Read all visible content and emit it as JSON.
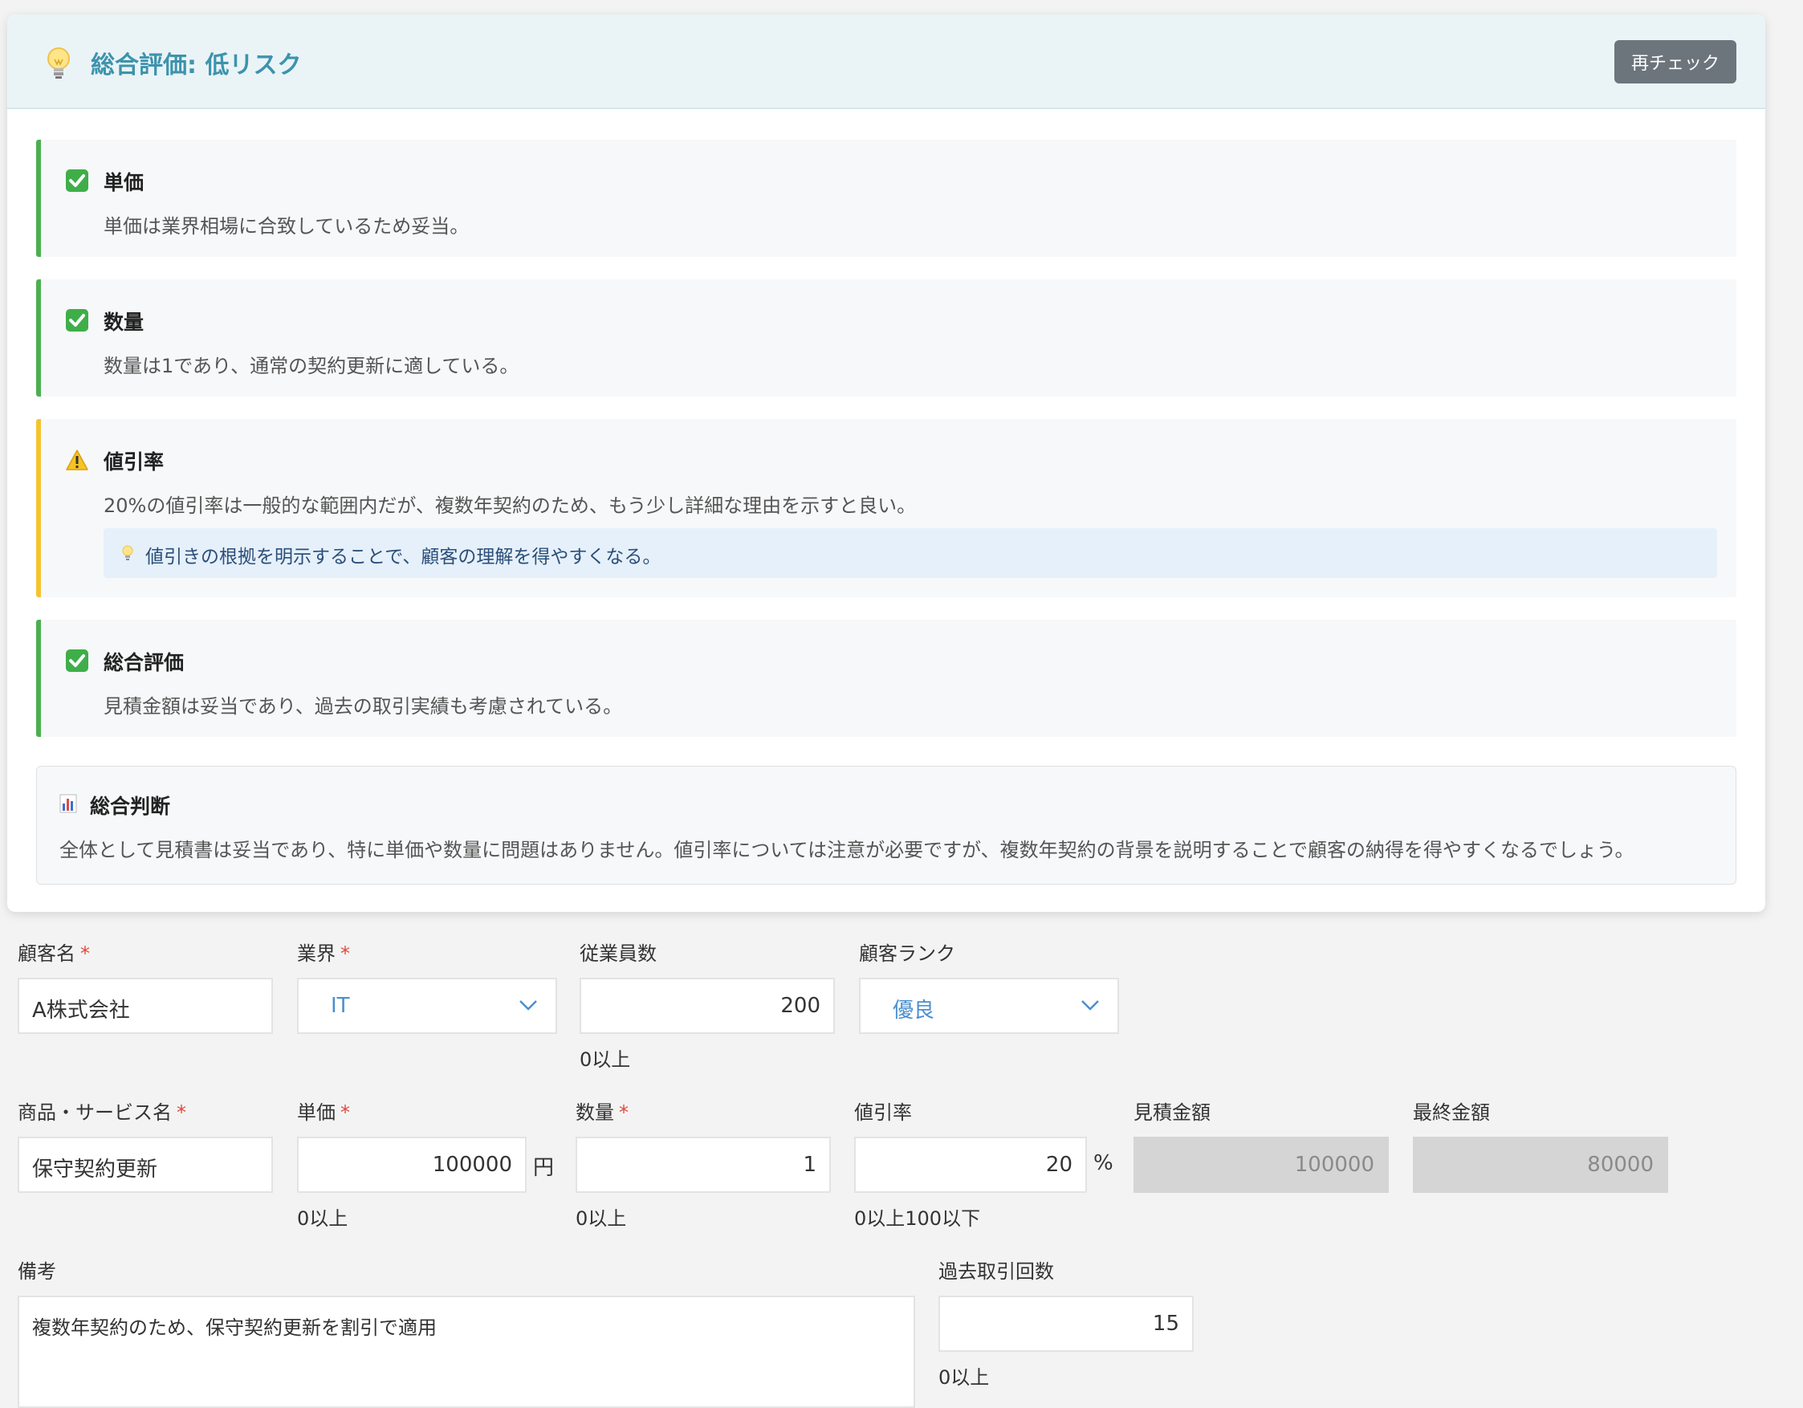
{
  "evaluation": {
    "title": "総合評価: 低リスク",
    "recheck_label": "再チェック",
    "items": [
      {
        "status": "ok",
        "title": "単価",
        "description": "単価は業界相場に合致しているため妥当。"
      },
      {
        "status": "ok",
        "title": "数量",
        "description": "数量は1であり、通常の契約更新に適している。"
      },
      {
        "status": "warning",
        "title": "値引率",
        "description": "20%の値引率は一般的な範囲内だが、複数年契約のため、もう少し詳細な理由を示すと良い。",
        "hint": "値引きの根拠を明示することで、顧客の理解を得やすくなる。"
      },
      {
        "status": "ok",
        "title": "総合評価",
        "description": "見積金額は妥当であり、過去の取引実績も考慮されている。"
      }
    ],
    "summary": {
      "title": "総合判断",
      "body": "全体として見積書は妥当であり、特に単価や数量に問題はありません。値引率については注意が必要ですが、複数年契約の背景を説明することで顧客の納得を得やすくなるでしょう。"
    }
  },
  "form": {
    "required_mark": "*",
    "customer_name": {
      "label": "顧客名",
      "value": "A株式会社"
    },
    "industry": {
      "label": "業界",
      "value": "IT"
    },
    "employees": {
      "label": "従業員数",
      "value": "200",
      "helper": "0以上"
    },
    "customer_rank": {
      "label": "顧客ランク",
      "value": "優良"
    },
    "product": {
      "label": "商品・サービス名",
      "value": "保守契約更新"
    },
    "unit_price": {
      "label": "単価",
      "value": "100000",
      "unit": "円",
      "helper": "0以上"
    },
    "quantity": {
      "label": "数量",
      "value": "1",
      "helper": "0以上"
    },
    "discount_rate": {
      "label": "値引率",
      "value": "20",
      "unit": "%",
      "helper": "0以上100以下"
    },
    "estimate_amount": {
      "label": "見積金額",
      "value": "100000"
    },
    "final_amount": {
      "label": "最終金額",
      "value": "80000"
    },
    "remarks": {
      "label": "備考",
      "value": "複数年契約のため、保守契約更新を割引で適用"
    },
    "past_transactions": {
      "label": "過去取引回数",
      "value": "15",
      "helper": "0以上"
    }
  },
  "colors": {
    "accent": "#3d93ad",
    "ok": "#4caf50",
    "warning": "#f4c430",
    "required": "#e0483b",
    "select_text": "#4a8fd0"
  },
  "icons": {
    "header": "lightbulb-icon",
    "ok": "check-box-icon",
    "warning": "warning-icon",
    "hint": "lightbulb-icon",
    "summary": "bar-chart-icon",
    "select": "chevron-down-icon"
  }
}
